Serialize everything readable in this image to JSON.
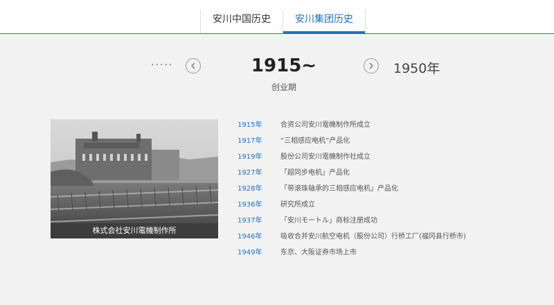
{
  "tabs": [
    {
      "label": "安川中国历史"
    },
    {
      "label": "安川集团历史"
    }
  ],
  "period": {
    "previous_indicator": "·····",
    "current_title": "1915~",
    "current_subtitle": "创业期",
    "next_title": "1950年"
  },
  "photo": {
    "caption": "株式会社安川電機制作所"
  },
  "timeline": [
    {
      "year": "1915年",
      "event": "合资公司安川電機制作所成立"
    },
    {
      "year": "1917年",
      "event": "“三相感应电机”产品化"
    },
    {
      "year": "1919年",
      "event": "股份公司安川電機制作社成立"
    },
    {
      "year": "1927年",
      "event": "「超同步电机」产品化"
    },
    {
      "year": "1928年",
      "event": "「带滚珠轴承的三相感应电机」产品化"
    },
    {
      "year": "1936年",
      "event": "研究所成立"
    },
    {
      "year": "1937年",
      "event": "「安川モートル」商标注册成功"
    },
    {
      "year": "1946年",
      "event": "吸收合并安川航空电机（股份公司）行桥工厂(福冈县行桥市)"
    },
    {
      "year": "1949年",
      "event": "东京、大阪证券市场上市"
    }
  ],
  "colors": {
    "accent": "#1f6fbf",
    "background": "#f2f2f2"
  }
}
